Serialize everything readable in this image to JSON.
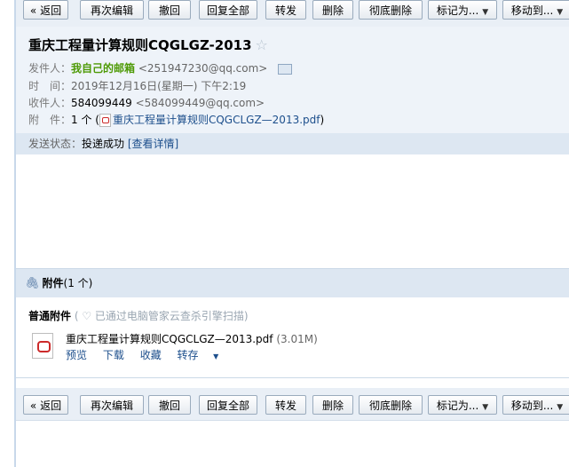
{
  "toolbar": {
    "back": "« 返回",
    "reedit": "再次编辑",
    "recall": "撤回",
    "reply_all": "回复全部",
    "forward": "转发",
    "delete": "删除",
    "delete_perm": "彻底删除",
    "mark_as": "标记为...",
    "move_to": "移动到..."
  },
  "email": {
    "subject": "重庆工程量计算规则CQGLGZ-2013",
    "star": "☆",
    "from_label": "发件人：",
    "from_name": "我自己的邮箱",
    "from_addr": "<251947230@qq.com>",
    "time_label": "时　间：",
    "time_value": "2019年12月16日(星期一) 下午2:19",
    "to_label": "收件人：",
    "to_name": "584099449",
    "to_addr": "<584099449@qq.com>",
    "attach_label": "附　件：",
    "attach_count": "1 个 (",
    "attach_file": "重庆工程量计算规则CQGCLGZ—2013.pdf",
    "attach_close": ")",
    "status_label": "发送状态：",
    "status_value": "投递成功",
    "status_link": "[查看详情]"
  },
  "attachments": {
    "title": "附件",
    "count": "(1 个)",
    "normal_label": "普通附件",
    "scan_note": "( ♡ 已通过电脑管家云查杀引擎扫描)",
    "file_name": "重庆工程量计算规则CQGCLGZ—2013.pdf",
    "file_size": "(3.01M)",
    "actions": {
      "preview": "预览",
      "download": "下载",
      "collect": "收藏",
      "save": "转存"
    }
  }
}
